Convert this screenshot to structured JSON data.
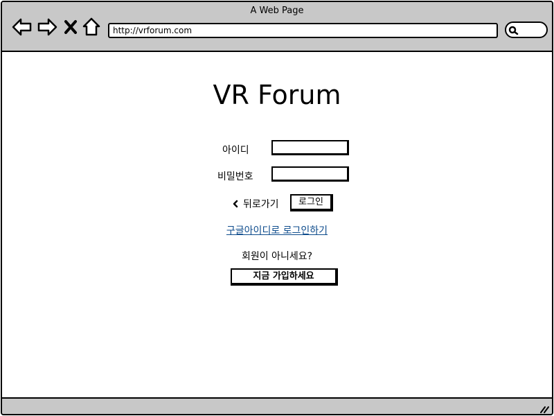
{
  "window": {
    "title": "A Web Page"
  },
  "browser": {
    "url": "http://vrforum.com"
  },
  "page": {
    "title": "VR Forum",
    "id_label": "아이디",
    "password_label": "비밀번호",
    "back_label": "뒤로가기",
    "login_button": "로그인",
    "google_login_link": "구글아이디로 로그인하기",
    "not_member_text": "회원이 아니세요?",
    "signup_button": "지금 가입하세요"
  },
  "icons": [
    "back-arrow-icon",
    "forward-arrow-icon",
    "close-icon",
    "home-icon",
    "search-icon",
    "chevron-left-icon",
    "resize-grip-icon"
  ]
}
